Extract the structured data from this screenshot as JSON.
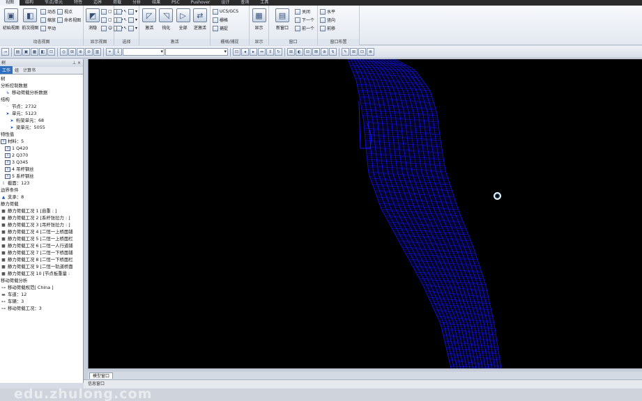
{
  "menubar": {
    "items": [
      "视图",
      "结构",
      "节点/单元",
      "特性",
      "边界",
      "荷载",
      "分析",
      "结果",
      "PSC",
      "Pushover",
      "设计",
      "查询",
      "工具"
    ],
    "active_index": 0
  },
  "ribbon": {
    "groups": [
      {
        "label": "动态视图",
        "big": [
          {
            "label": "初始视图",
            "icon": "initial-view-icon"
          },
          {
            "label": "前次视图",
            "icon": "previous-view-icon"
          }
        ],
        "small": [
          [
            "动态",
            "缩放",
            "平动"
          ],
          [
            "视点",
            "命名视图"
          ]
        ]
      },
      {
        "label": "显示视图",
        "big": [
          {
            "label": "消隐",
            "icon": "hide-icon"
          }
        ],
        "small": [
          [
            "▢",
            "▢",
            "☺"
          ],
          [
            "▾",
            "▾",
            "▾"
          ]
        ]
      },
      {
        "label": "选择",
        "big": [],
        "small": [
          [
            "↖",
            "↖",
            "↖"
          ],
          [
            "▾",
            "▾",
            "▾"
          ]
        ]
      },
      {
        "label": "激活",
        "big": [
          {
            "label": "激活",
            "icon": "activate-icon"
          },
          {
            "label": "钝化",
            "icon": "inactivate-icon"
          },
          {
            "label": "全部",
            "icon": "all-icon"
          },
          {
            "label": "逆激活",
            "icon": "inverse-activate-icon"
          }
        ],
        "small": []
      },
      {
        "label": "栅格/捕捉",
        "big": [],
        "small": [
          [
            "UCS/GCS",
            "栅格",
            "捕捉"
          ]
        ]
      },
      {
        "label": "显示",
        "big": [
          {
            "label": "显示",
            "icon": "display-icon"
          }
        ],
        "small": []
      },
      {
        "label": "窗口",
        "big": [
          {
            "label": "新窗口",
            "icon": "new-window-icon"
          }
        ],
        "small": [
          [
            "关闭",
            "下一个",
            "前一个"
          ]
        ]
      },
      {
        "label": "窗口布置",
        "big": [],
        "small": [
          [
            "水平",
            "竖向",
            "前移"
          ]
        ]
      }
    ]
  },
  "toolbar": {
    "buttons": [
      "→",
      "▤",
      "▣",
      "▦",
      "◧",
      "⊡",
      "◎",
      "⊞",
      "⊕",
      "⊘",
      "▥",
      "⌖",
      "↧"
    ],
    "buttons_right": [
      "⊡",
      "◂",
      "▸",
      "⇔",
      "⇕",
      "↻",
      "⊞",
      "◐",
      "⊟",
      "⊠",
      "⊕",
      "↯",
      "✎",
      "⊞",
      "⊡",
      "⊗"
    ]
  },
  "panel": {
    "title": "树",
    "tabs": [
      "工作",
      "组",
      "计算书"
    ],
    "active_tab": 0,
    "tree": [
      {
        "indent": 0,
        "icon": "",
        "text": "树"
      },
      {
        "indent": 0,
        "icon": "",
        "text": "分析控制数据"
      },
      {
        "indent": 1,
        "icon": "↳",
        "text": "移动荷载分析数据"
      },
      {
        "indent": 0,
        "icon": "",
        "text": "结构"
      },
      {
        "indent": 1,
        "icon": "·",
        "text": "节点：2732"
      },
      {
        "indent": 1,
        "icon": "➤",
        "text": "单元：5123"
      },
      {
        "indent": 2,
        "icon": "➤",
        "text": "桁架单元：68"
      },
      {
        "indent": 2,
        "icon": "➤",
        "text": "梁单元：5055"
      },
      {
        "indent": 0,
        "icon": "",
        "text": "特性值"
      },
      {
        "indent": 0,
        "icon": "box",
        "text": "材料：5"
      },
      {
        "indent": 1,
        "icon": "box",
        "text": "1   Q420"
      },
      {
        "indent": 1,
        "icon": "box",
        "text": "2   Q370"
      },
      {
        "indent": 1,
        "icon": "box",
        "text": "3   Q345"
      },
      {
        "indent": 1,
        "icon": "box",
        "text": "4   吊杆钢丝"
      },
      {
        "indent": 1,
        "icon": "box",
        "text": "5   系杆钢丝"
      },
      {
        "indent": 0,
        "icon": "I",
        "text": "截面：123"
      },
      {
        "indent": 0,
        "icon": "",
        "text": "边界条件"
      },
      {
        "indent": 0,
        "icon": "▲",
        "text": "支承：8"
      },
      {
        "indent": 0,
        "icon": "",
        "text": "静力荷载"
      },
      {
        "indent": 0,
        "icon": "■",
        "text": "静力荷载工况 1 [自重 : ]"
      },
      {
        "indent": 0,
        "icon": "■",
        "text": "静力荷载工况 2 [系杆张拉力 : ]"
      },
      {
        "indent": 0,
        "icon": "■",
        "text": "静力荷载工况 3 [吊杆张拉力 : ]"
      },
      {
        "indent": 0,
        "icon": "■",
        "text": "静力荷载工况 4 [二恒一上桥面铺"
      },
      {
        "indent": 0,
        "icon": "■",
        "text": "静力荷载工况 5 [二恒一上桥面栏"
      },
      {
        "indent": 0,
        "icon": "■",
        "text": "静力荷载工况 6 [二恒一人行道铺"
      },
      {
        "indent": 0,
        "icon": "■",
        "text": "静力荷载工况 7 [二恒一下桥面铺"
      },
      {
        "indent": 0,
        "icon": "■",
        "text": "静力荷载工况 8 [二恒一下桥面栏"
      },
      {
        "indent": 0,
        "icon": "■",
        "text": "静力荷载工况 9 [二恒一轨道桥面"
      },
      {
        "indent": 0,
        "icon": "■",
        "text": "静力荷载工况 10 [节点板重量 :"
      },
      {
        "indent": 0,
        "icon": "",
        "text": "移动荷载分析"
      },
      {
        "indent": 0,
        "icon": "⊶",
        "text": "移动荷载规范[ China ]"
      },
      {
        "indent": 0,
        "icon": "▬",
        "text": "车道：12"
      },
      {
        "indent": 0,
        "icon": "⊷",
        "text": "车辆：3"
      },
      {
        "indent": 0,
        "icon": "⊶",
        "text": "移动荷载工况：3"
      }
    ]
  },
  "view_tabs": [
    "模型窗口"
  ],
  "status": {
    "message_window": "信息窗口"
  },
  "watermark": "edu.zhulong.com",
  "colors": {
    "mesh": "#1515ff",
    "viewport_bg": "#000000",
    "accent": "#2f6fc0"
  }
}
